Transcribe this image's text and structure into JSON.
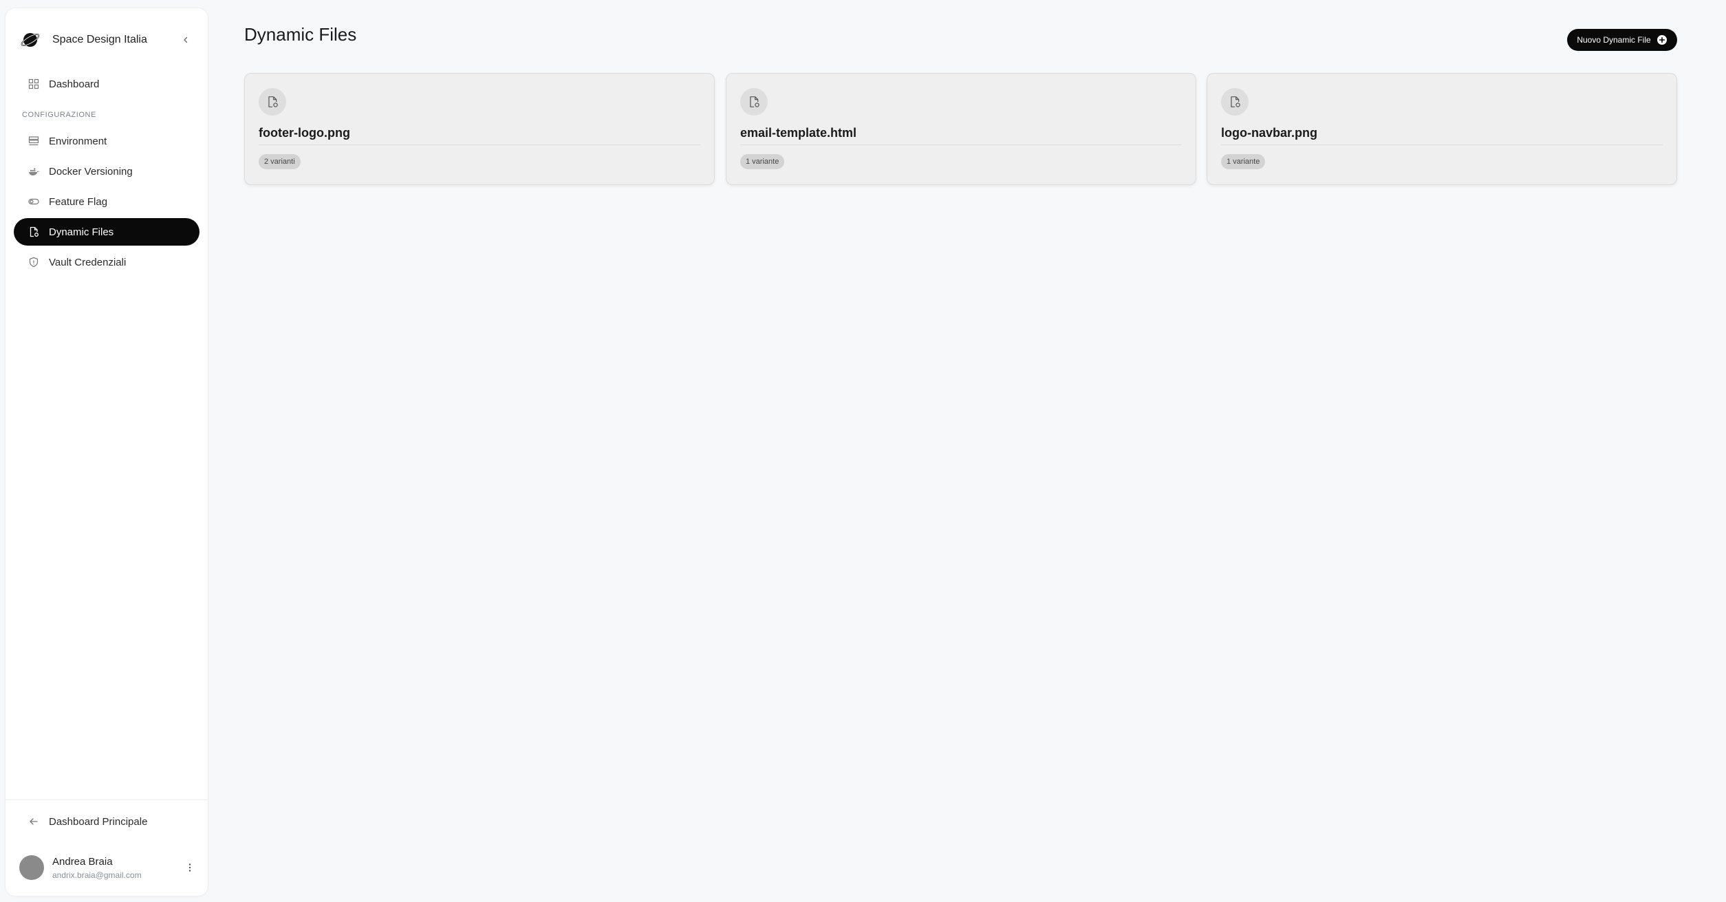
{
  "sidebar": {
    "brand": {
      "name": "Space Design Italia",
      "icon": "planet-icon"
    },
    "nav": {
      "dashboard": "Dashboard",
      "section_label": "CONFIGURAZIONE",
      "environment": "Environment",
      "docker": "Docker Versioning",
      "feature_flag": "Feature Flag",
      "dynamic_files": "Dynamic Files",
      "vault": "Vault Credenziali"
    },
    "active_item": "Dynamic Files",
    "back_link": "Dashboard Principale",
    "user": {
      "name": "Andrea Braia",
      "email": "andrix.braia@gmail.com"
    }
  },
  "main": {
    "title": "Dynamic Files",
    "new_button": "Nuovo Dynamic File",
    "files": [
      {
        "name": "footer-logo.png",
        "variants": "2 varianti"
      },
      {
        "name": "email-template.html",
        "variants": "1 variante"
      },
      {
        "name": "logo-navbar.png",
        "variants": "1 variante"
      }
    ]
  },
  "colors": {
    "accent": "#0a0a0a",
    "background": "#f7f8f9",
    "card": "#efefef",
    "badge": "#d3d3d3"
  }
}
